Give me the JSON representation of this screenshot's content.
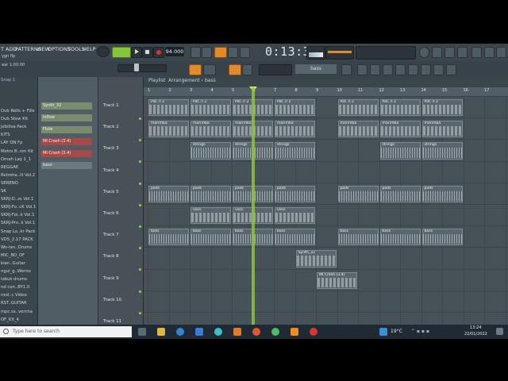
{
  "menu": {
    "items": [
      "T",
      "ADD",
      "PATTERNS",
      "VIEW",
      "OPTIONS",
      "TOOLS",
      "HELP"
    ]
  },
  "transport": {
    "tempo": "94.000",
    "time": "0:13:31"
  },
  "left_info": {
    "line1": "ygn flp",
    "line2": "ear 1:00:00"
  },
  "pattern_selector": "bass",
  "playlist_header": {
    "title": "Playlist",
    "path": "Arrangement › bass"
  },
  "browser": {
    "title": "Snap 1",
    "items": [
      "Dub Rolls + Fills",
      "Dub Stew Kit",
      "Jebilisa Pack",
      "KITS",
      "LAY ON Fp",
      "Metro B..nm Kit",
      "Omah Lay 1_1",
      "REGGAE",
      "Retroha..ili Vol.2",
      "SERENO",
      "SK",
      "SKRJ-D..ss Vol.1",
      "SKRJ-Fu..cK Vol.1",
      "SKRJ-Fol..k Vol.1",
      "SKRJ-Pro..k Vol.1",
      "Snap Lo..kr Pack",
      "VDS_2.17 PACK",
      "Wo-lan..Drums",
      "MIC_BO_OF",
      "kian..Guitar",
      "ngui_g..Werno",
      "lobuk drums",
      "nd con..BY1.0",
      "ned..c Video",
      "RST..GUITAR",
      "mpc.ss..vercha",
      "OF_Kit_4"
    ]
  },
  "channels": [
    {
      "name": "Synth_32",
      "color": "green"
    },
    {
      "name": "Inflow",
      "color": "green"
    },
    {
      "name": "Flute",
      "color": "green"
    },
    {
      "name": "MI Crash (3.4)",
      "color": "red"
    },
    {
      "name": "MI Crash (3.4)",
      "color": "red"
    },
    {
      "name": "bass",
      "color": "gray"
    }
  ],
  "tracks": [
    "Track 1",
    "Track 2",
    "Track 3",
    "Track 4",
    "Track 5",
    "Track 6",
    "Track 7",
    "Track 8",
    "Track 9",
    "Track 10",
    "Track 11"
  ],
  "ruler_ticks": [
    "1",
    "2",
    "3",
    "4",
    "5",
    "6",
    "7",
    "8",
    "9",
    "10",
    "11",
    "12",
    "13",
    "14",
    "15",
    "16",
    "17"
  ],
  "clip_labels": {
    "pat": "Pat..n 2",
    "marimba": "marimba",
    "strings": "strings",
    "pads": "pads",
    "vocs": "vocs",
    "bass": "bass",
    "synth": "Synth_32",
    "crash": "MI Crash (3.4)"
  },
  "taskbar": {
    "search_placeholder": "Type here to search",
    "temperature": "19°C",
    "time": "13:24",
    "date": "22/01/2022"
  },
  "colors": {
    "accent_orange": "#e58a2b",
    "playhead_green": "#8dc63f",
    "record_red": "#c93b34"
  }
}
